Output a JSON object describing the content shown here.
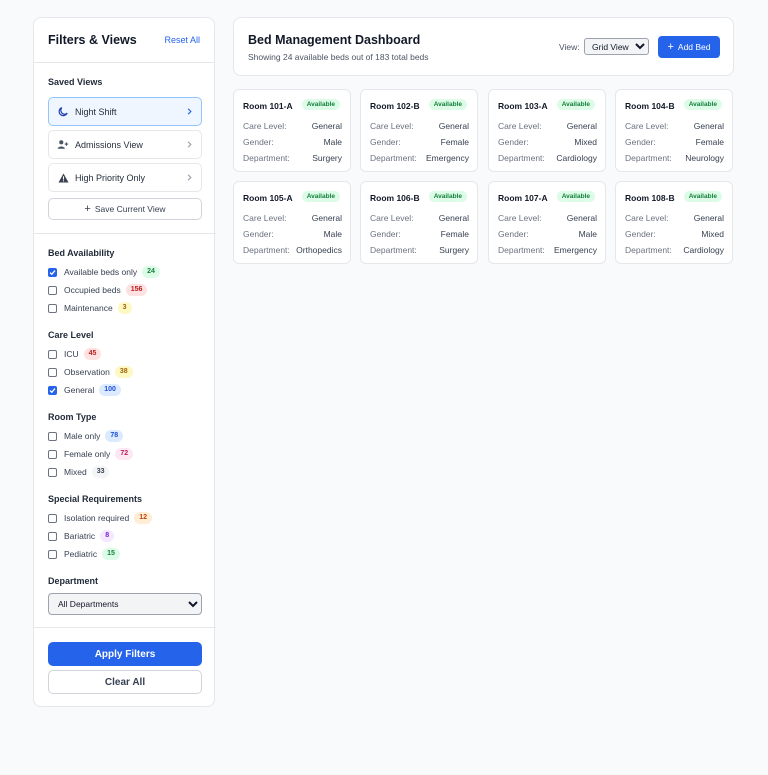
{
  "sidebar": {
    "title": "Filters & Views",
    "reset_label": "Reset All",
    "saved_views_label": "Saved Views",
    "saved_views": [
      {
        "label": "Night Shift",
        "icon": "moon-icon",
        "active": true
      },
      {
        "label": "Admissions View",
        "icon": "user-plus-icon",
        "active": false
      },
      {
        "label": "High Priority Only",
        "icon": "warning-icon",
        "active": false
      }
    ],
    "save_view_label": "Save Current View",
    "groups": [
      {
        "title": "Bed Availability",
        "items": [
          {
            "label": "Available beds only",
            "count": "24",
            "checked": true,
            "badge_bg": "#dcfce7",
            "badge_fg": "#15803d"
          },
          {
            "label": "Occupied beds",
            "count": "156",
            "checked": false,
            "badge_bg": "#fee2e2",
            "badge_fg": "#b91c1c"
          },
          {
            "label": "Maintenance",
            "count": "3",
            "checked": false,
            "badge_bg": "#fef9c3",
            "badge_fg": "#a16207"
          }
        ]
      },
      {
        "title": "Care Level",
        "items": [
          {
            "label": "ICU",
            "count": "45",
            "checked": false,
            "badge_bg": "#fee2e2",
            "badge_fg": "#b91c1c"
          },
          {
            "label": "Observation",
            "count": "38",
            "checked": false,
            "badge_bg": "#fef9c3",
            "badge_fg": "#a16207"
          },
          {
            "label": "General",
            "count": "100",
            "checked": true,
            "badge_bg": "#dbeafe",
            "badge_fg": "#1d4ed8"
          }
        ]
      },
      {
        "title": "Room Type",
        "items": [
          {
            "label": "Male only",
            "count": "78",
            "checked": false,
            "badge_bg": "#dbeafe",
            "badge_fg": "#1d4ed8"
          },
          {
            "label": "Female only",
            "count": "72",
            "checked": false,
            "badge_bg": "#fce7f3",
            "badge_fg": "#be185d"
          },
          {
            "label": "Mixed",
            "count": "33",
            "checked": false,
            "badge_bg": "#f3f4f6",
            "badge_fg": "#374151"
          }
        ]
      },
      {
        "title": "Special Requirements",
        "items": [
          {
            "label": "Isolation required",
            "count": "12",
            "checked": false,
            "badge_bg": "#ffedd5",
            "badge_fg": "#c2410c"
          },
          {
            "label": "Bariatric",
            "count": "8",
            "checked": false,
            "badge_bg": "#f3e8ff",
            "badge_fg": "#7e22ce"
          },
          {
            "label": "Pediatric",
            "count": "15",
            "checked": false,
            "badge_bg": "#dcfce7",
            "badge_fg": "#15803d"
          }
        ]
      }
    ],
    "department_label": "Department",
    "department_value": "All Departments",
    "apply_label": "Apply Filters",
    "clear_label": "Clear All"
  },
  "header": {
    "title": "Bed Management Dashboard",
    "subtitle": "Showing 24 available beds out of 183 total beds",
    "view_label": "View:",
    "view_value": "Grid View",
    "add_bed_label": "Add Bed"
  },
  "card_labels": {
    "care": "Care Level:",
    "gender": "Gender:",
    "dept": "Department:"
  },
  "beds": [
    {
      "room": "Room 101-A",
      "status": "Available",
      "care": "General",
      "gender": "Male",
      "dept": "Surgery"
    },
    {
      "room": "Room 102-B",
      "status": "Available",
      "care": "General",
      "gender": "Female",
      "dept": "Emergency"
    },
    {
      "room": "Room 103-A",
      "status": "Available",
      "care": "General",
      "gender": "Mixed",
      "dept": "Cardiology"
    },
    {
      "room": "Room 104-B",
      "status": "Available",
      "care": "General",
      "gender": "Female",
      "dept": "Neurology"
    },
    {
      "room": "Room 105-A",
      "status": "Available",
      "care": "General",
      "gender": "Male",
      "dept": "Orthopedics"
    },
    {
      "room": "Room 106-B",
      "status": "Available",
      "care": "General",
      "gender": "Female",
      "dept": "Surgery"
    },
    {
      "room": "Room 107-A",
      "status": "Available",
      "care": "General",
      "gender": "Male",
      "dept": "Emergency"
    },
    {
      "room": "Room 108-B",
      "status": "Available",
      "care": "General",
      "gender": "Mixed",
      "dept": "Cardiology"
    }
  ],
  "colors": {
    "accent": "#2563eb",
    "available_bg": "#dcfce7",
    "available_fg": "#15803d"
  }
}
